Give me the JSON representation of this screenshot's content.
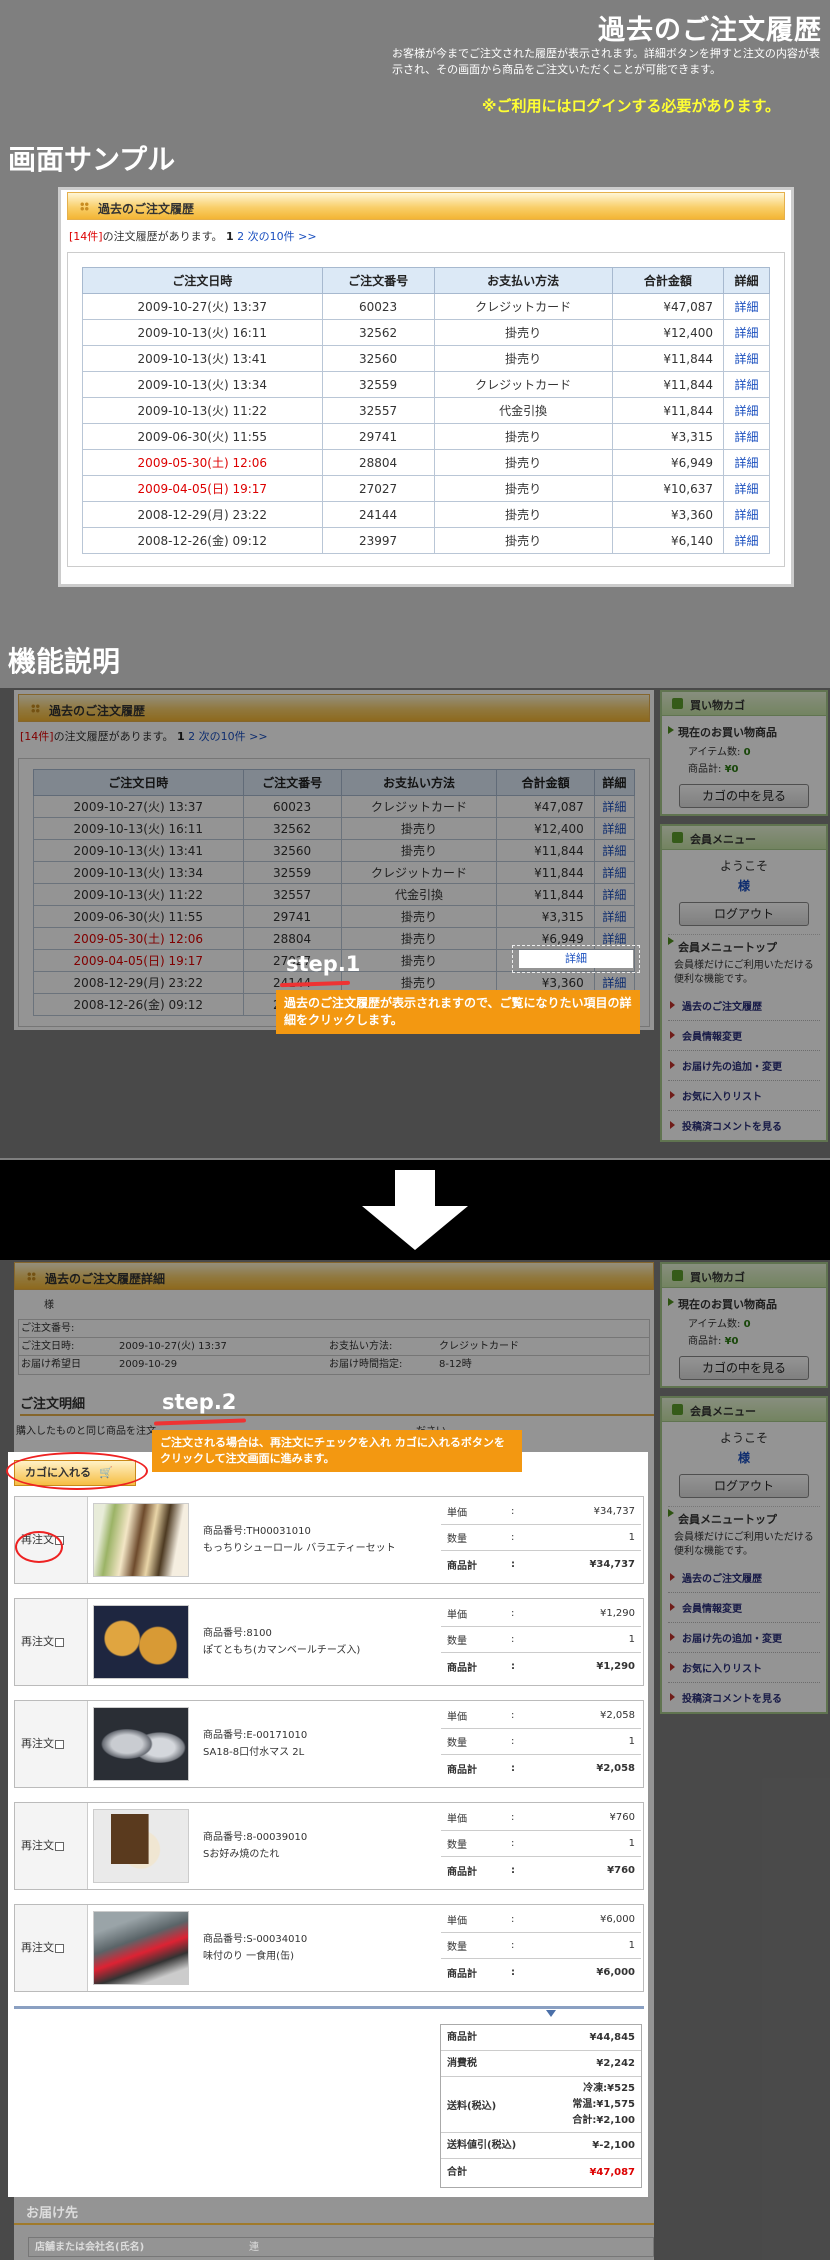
{
  "header": {
    "title": "過去のご注文履歴",
    "description": "お客様が今までご注文された履歴が表示されます。詳細ボタンを押すと注文の内容が表示され、その画面から商品をご注文いただくことが可能できます。",
    "login_note": "※ご利用にはログインする必要があります。"
  },
  "sections": {
    "sample": "画面サンプル",
    "function": "機能説明"
  },
  "history": {
    "title": "過去のご注文履歴",
    "count_prefix": "[14件]",
    "count_suffix": "の注文履歴があります。",
    "page1": "1",
    "page2": "2",
    "next": "次の10件 >>",
    "columns": [
      "ご注文日時",
      "ご注文番号",
      "お支払い方法",
      "合計金額",
      "詳細"
    ],
    "rows": [
      {
        "date": "2009-10-27(火) 13:37",
        "no": "60023",
        "pay": "クレジットカード",
        "total": "¥47,087",
        "detail": "詳細",
        "red": false
      },
      {
        "date": "2009-10-13(火) 16:11",
        "no": "32562",
        "pay": "掛売り",
        "total": "¥12,400",
        "detail": "詳細",
        "red": false
      },
      {
        "date": "2009-10-13(火) 13:41",
        "no": "32560",
        "pay": "掛売り",
        "total": "¥11,844",
        "detail": "詳細",
        "red": false
      },
      {
        "date": "2009-10-13(火) 13:34",
        "no": "32559",
        "pay": "クレジットカード",
        "total": "¥11,844",
        "detail": "詳細",
        "red": false
      },
      {
        "date": "2009-10-13(火) 11:22",
        "no": "32557",
        "pay": "代金引換",
        "total": "¥11,844",
        "detail": "詳細",
        "red": false
      },
      {
        "date": "2009-06-30(火) 11:55",
        "no": "29741",
        "pay": "掛売り",
        "total": "¥3,315",
        "detail": "詳細",
        "red": false
      },
      {
        "date": "2009-05-30(土) 12:06",
        "no": "28804",
        "pay": "掛売り",
        "total": "¥6,949",
        "detail": "詳細",
        "red": true
      },
      {
        "date": "2009-04-05(日) 19:17",
        "no": "27027",
        "pay": "掛売り",
        "total": "¥10,637",
        "detail": "詳細",
        "red": true
      },
      {
        "date": "2008-12-29(月) 23:22",
        "no": "24144",
        "pay": "掛売り",
        "total": "¥3,360",
        "detail": "詳細",
        "red": false
      },
      {
        "date": "2008-12-26(金) 09:12",
        "no": "23997",
        "pay": "掛売り",
        "total": "¥6,140",
        "detail": "詳細",
        "red": false
      }
    ]
  },
  "cart": {
    "title": "買い物カゴ",
    "current": "現在のお買い物商品",
    "items_label": "アイテム数:",
    "items": "0",
    "subtotal_label": "商品計:",
    "subtotal": "¥0",
    "button": "カゴの中を見る"
  },
  "member": {
    "title": "会員メニュー",
    "welcome": "ようこそ",
    "sama": "様",
    "logout": "ログアウト",
    "top": "会員メニュートップ",
    "desc": "会員様だけにご利用いただける便利な機能です。",
    "links": [
      "過去のご注文履歴",
      "会員情報変更",
      "お届け先の追加・変更",
      "お気に入りリスト",
      "投稿済コメントを見る"
    ]
  },
  "step1": {
    "label": "step.1",
    "text": "過去のご注文履歴が表示されますので、ご覧になりたい項目の詳細をクリックします。"
  },
  "step2": {
    "label": "step.2",
    "text": "ご注文される場合は、再注文にチェックを入れ カゴに入れるボタンをクリックして注文画面に進みます。"
  },
  "detail": {
    "title": "過去のご注文履歴詳細",
    "sama": "様",
    "labels": {
      "order_no": "ご注文番号:",
      "order_date": "ご注文日時:",
      "pay": "お支払い方法:",
      "wish": "お届け希望日",
      "time": "お届け時間指定:"
    },
    "values": {
      "order_date": "2009-10-27(火) 13:37",
      "pay": "クレジットカード",
      "wish": "2009-10-29",
      "time": "8-12時"
    },
    "meisai": "ご注文明細",
    "note": "購入したものと同じ商品を注文",
    "note2": "ださい。",
    "cart_btn": "カゴに入れる",
    "reorder": "再注文",
    "price_labels": [
      "単価",
      "数量",
      "商品計"
    ],
    "items": [
      {
        "code": "商品番号:TH00031010",
        "name": "もっちりシューロール バラエティーセット",
        "price": "¥34,737",
        "qty": "1",
        "sub": "¥34,737"
      },
      {
        "code": "商品番号:8100",
        "name": "ぽてともち(カマンベールチーズ入)",
        "price": "¥1,290",
        "qty": "1",
        "sub": "¥1,290"
      },
      {
        "code": "商品番号:E-00171010",
        "name": "SA18-8口付水マス 2L",
        "price": "¥2,058",
        "qty": "1",
        "sub": "¥2,058"
      },
      {
        "code": "商品番号:8-00039010",
        "name": "Sお好み焼のたれ",
        "price": "¥760",
        "qty": "1",
        "sub": "¥760"
      },
      {
        "code": "商品番号:S-00034010",
        "name": "味付のり 一食用(缶)",
        "price": "¥6,000",
        "qty": "1",
        "sub": "¥6,000"
      }
    ],
    "summary": {
      "goods_label": "商品計",
      "goods": "¥44,845",
      "tax_label": "消費税",
      "tax": "¥2,242",
      "ship_label": "送料(税込)",
      "ship1": "冷凍:¥525",
      "ship2": "常温:¥1,575",
      "ship3": "合計:¥2,100",
      "disc_label": "送料値引(税込)",
      "disc": "¥-2,100",
      "total_label": "合計",
      "total": "¥47,087"
    },
    "delivery": "お届け先",
    "store_label": "店舗または会社名(氏名)",
    "store_val": "連"
  },
  "colors": {
    "accent_red": "#d00000",
    "callout": "#f39811",
    "header_yellow": "#ffff33"
  }
}
